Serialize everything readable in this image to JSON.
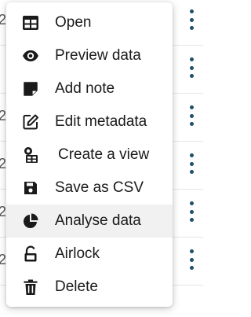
{
  "background_rows": [
    {
      "number_fragment": "2"
    },
    {
      "number_fragment": ""
    },
    {
      "number_fragment": "2"
    },
    {
      "number_fragment": "2"
    },
    {
      "number_fragment": "2"
    },
    {
      "number_fragment": "2"
    }
  ],
  "menu": {
    "items": [
      {
        "label": "Open",
        "icon": "table-icon"
      },
      {
        "label": "Preview data",
        "icon": "eye-icon"
      },
      {
        "label": "Add note",
        "icon": "sticky-note-icon"
      },
      {
        "label": "Edit metadata",
        "icon": "edit-icon"
      },
      {
        "label": "Create a view",
        "icon": "create-view-icon"
      },
      {
        "label": "Save as CSV",
        "icon": "save-icon"
      },
      {
        "label": "Analyse data",
        "icon": "pie-chart-icon",
        "highlighted": true
      },
      {
        "label": "Airlock",
        "icon": "unlock-icon"
      },
      {
        "label": "Delete",
        "icon": "trash-icon"
      }
    ]
  },
  "colors": {
    "kebab": "#1f4e6b",
    "highlight": "#f1f1f1",
    "text": "#1a1a1a"
  }
}
